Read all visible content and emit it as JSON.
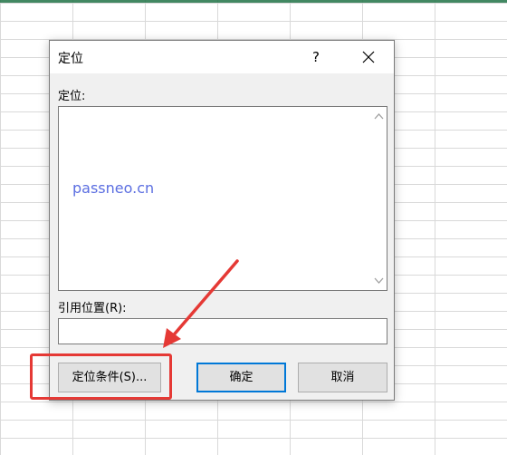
{
  "dialog": {
    "title": "定位",
    "help_label": "?",
    "goto_label": "定位:",
    "watermark": "passneo.cn",
    "reference_label": "引用位置(R):",
    "reference_value": "",
    "buttons": {
      "special": "定位条件(S)...",
      "ok": "确定",
      "cancel": "取消"
    }
  },
  "colors": {
    "annotation": "#e53935",
    "default_button_border": "#0078d7",
    "watermark": "#5b6ee1"
  },
  "icons": [
    "close-icon",
    "scroll-up-icon",
    "scroll-down-icon",
    "arrow-annotation"
  ]
}
